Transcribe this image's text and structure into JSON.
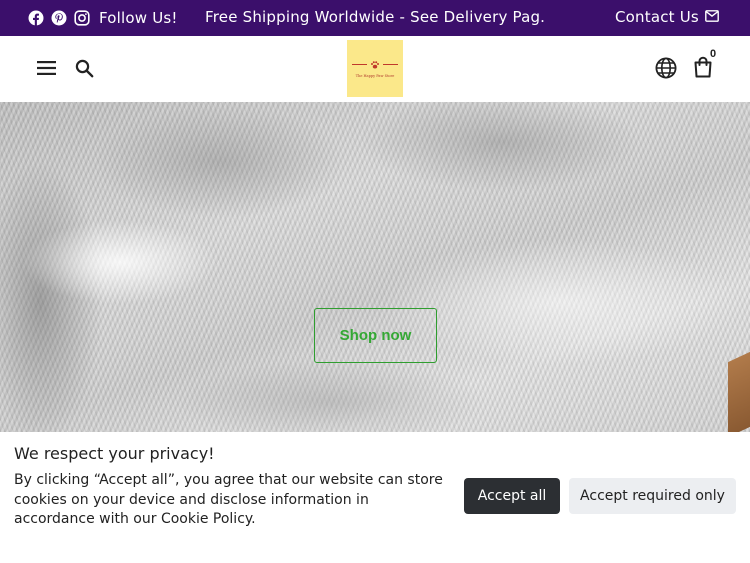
{
  "announcement_bar": {
    "social_icons": [
      "facebook-icon",
      "pinterest-icon",
      "instagram-icon"
    ],
    "follow_label": "Follow Us!",
    "announcement": "Free Shipping Worldwide - See Delivery Pag...",
    "contact_label": "Contact Us",
    "contact_icon": "mail-icon",
    "background_color": "#3b0f6b"
  },
  "header": {
    "menu_icon": "hamburger-menu-icon",
    "search_icon": "search-icon",
    "logo_text": "The Happy Paw Store",
    "language_icon": "globe-icon",
    "cart_icon": "shopping-bag-icon",
    "cart_count": "0",
    "logo_background": "#fbe88a"
  },
  "hero": {
    "button_label": "Shop now",
    "button_color": "#34a834"
  },
  "cookie_banner": {
    "title": "We respect your privacy!",
    "body": "By clicking “Accept all”, you agree that our website can store cookies on your device and disclose information in accordance with our Cookie Policy.",
    "accept_all_label": "Accept all",
    "accept_required_label": "Accept required only",
    "accept_all_color": "#2c2f33",
    "accept_required_color": "#eceef1"
  }
}
